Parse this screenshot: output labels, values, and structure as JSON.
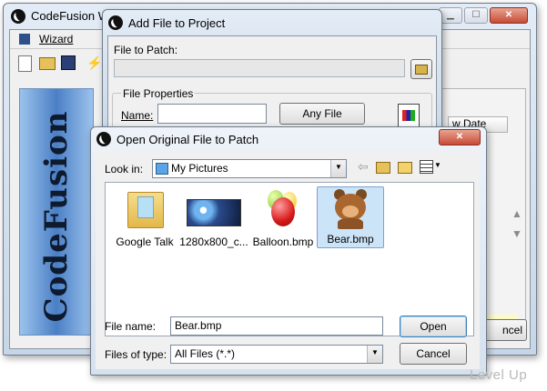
{
  "main_window": {
    "title": "CodeFusion W",
    "menu_item": "Wizard",
    "column_header": "w Date",
    "cancel_partial": "ncel"
  },
  "sidebar_banner_text": "CodeFusion",
  "add_dialog": {
    "title": "Add File to Project",
    "file_to_patch_label": "File to Patch:",
    "file_to_patch_value": "",
    "group_label": "File Properties",
    "name_label": "Name:",
    "name_value": "",
    "any_file_button": "Any File"
  },
  "open_dialog": {
    "title": "Open Original File to Patch",
    "look_in_label": "Look in:",
    "look_in_value": "My Pictures",
    "files": [
      {
        "name": "Google Talk",
        "icon": "folder-icon"
      },
      {
        "name": "1280x800_c...",
        "icon": "image-thumbnail-icon"
      },
      {
        "name": "Balloon.bmp",
        "icon": "balloon-icon"
      },
      {
        "name": "Bear.bmp",
        "icon": "bear-icon",
        "selected": true
      }
    ],
    "file_name_label": "File name:",
    "file_name_value": "Bear.bmp",
    "files_of_type_label": "Files of type:",
    "files_of_type_value": "All Files (*.*)",
    "open_button": "Open",
    "cancel_button": "Cancel"
  },
  "watermark": "Level Up",
  "colors": {
    "selection": "#cce4f7",
    "selection_border": "#7da2ce",
    "banner_blue": "#5a8fd0",
    "title_bar": "#d4e1ef"
  }
}
